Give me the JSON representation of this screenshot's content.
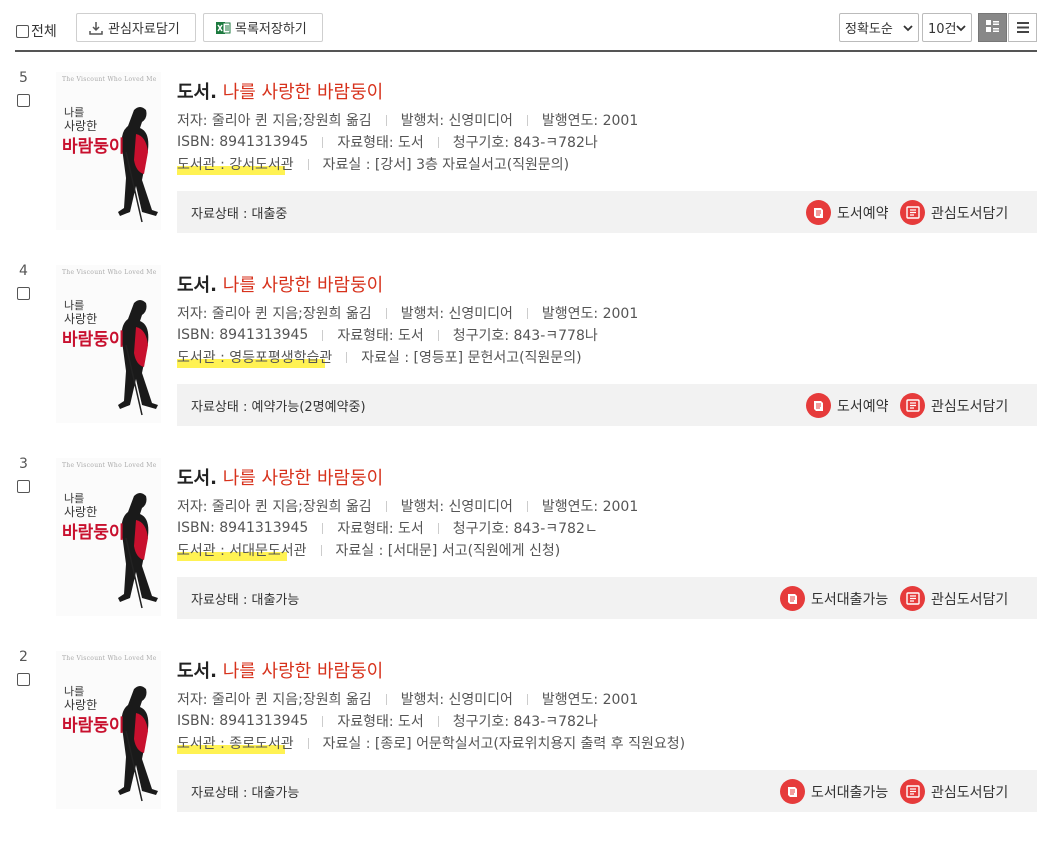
{
  "toolbar": {
    "select_all_label": "전체",
    "add_interest_label": "관심자료담기",
    "save_list_label": "목록저장하기",
    "sort_value": "정확도순",
    "page_size_value": "10건"
  },
  "cover": {
    "english_title": "The Viscount Who Loved Me",
    "title_line1": "나를",
    "title_line2": "사랑한",
    "title_line3": "바람둥이"
  },
  "items": [
    {
      "number": "5",
      "type": "도서.",
      "title": "나를 사랑한 바람둥이",
      "author": "저자: 줄리아 퀸 지음;장원희 옮김",
      "publisher": "발행처: 신영미디어",
      "year": "발행연도: 2001",
      "isbn": "ISBN: 8941313945",
      "format": "자료형태: 도서",
      "call_number": "청구기호: 843-ㅋ782나",
      "library": "도서관 : 강서도서관",
      "location": "자료실 : [강서] 3층 자료실서고(직원문의)",
      "status": "자료상태 : 대출중",
      "action": "도서예약",
      "action_icon": "book-icon",
      "interest": "관심도서담기"
    },
    {
      "number": "4",
      "type": "도서.",
      "title": "나를 사랑한 바람둥이",
      "author": "저자: 줄리아 퀸 지음;장원희 옮김",
      "publisher": "발행처: 신영미디어",
      "year": "발행연도: 2001",
      "isbn": "ISBN: 8941313945",
      "format": "자료형태: 도서",
      "call_number": "청구기호: 843-ㅋ778나",
      "library": "도서관 : 영등포평생학습관",
      "location": "자료실 : [영등포] 문헌서고(직원문의)",
      "status": "자료상태 : 예약가능(2명예약중)",
      "action": "도서예약",
      "action_icon": "book-icon",
      "interest": "관심도서담기"
    },
    {
      "number": "3",
      "type": "도서.",
      "title": "나를 사랑한 바람둥이",
      "author": "저자: 줄리아 퀸 지음;장원희 옮김",
      "publisher": "발행처: 신영미디어",
      "year": "발행연도: 2001",
      "isbn": "ISBN: 8941313945",
      "format": "자료형태: 도서",
      "call_number": "청구기호: 843-ㅋ782ㄴ",
      "library": "도서관 : 서대문도서관",
      "location": "자료실 : [서대문] 서고(직원에게 신청)",
      "status": "자료상태 : 대출가능",
      "action": "도서대출가능",
      "action_icon": "book-icon",
      "interest": "관심도서담기"
    },
    {
      "number": "2",
      "type": "도서.",
      "title": "나를 사랑한 바람둥이",
      "author": "저자: 줄리아 퀸 지음;장원희 옮김",
      "publisher": "발행처: 신영미디어",
      "year": "발행연도: 2001",
      "isbn": "ISBN: 8941313945",
      "format": "자료형태: 도서",
      "call_number": "청구기호: 843-ㅋ782나",
      "library": "도서관 : 종로도서관",
      "location": "자료실 : [종로] 어문학실서고(자료위치용지 출력 후 직원요청)",
      "status": "자료상태 : 대출가능",
      "action": "도서대출가능",
      "action_icon": "book-icon",
      "interest": "관심도서담기"
    }
  ],
  "colors": {
    "accent_red": "#e63b3b",
    "title_red": "#d7321c",
    "highlight_yellow": "#ffee1a",
    "status_bg": "#f2f2f2"
  }
}
